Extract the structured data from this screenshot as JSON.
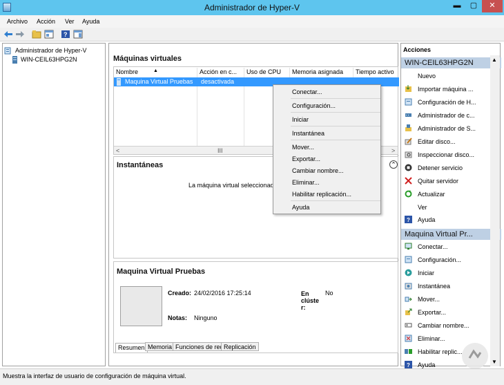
{
  "window": {
    "title": "Administrador de Hyper-V",
    "min": "▬",
    "max": "▢",
    "close": "✕"
  },
  "menu": [
    "Archivo",
    "Acción",
    "Ver",
    "Ayuda"
  ],
  "tree": {
    "root": "Administrador de Hyper-V",
    "server": "WIN-CEIL63HPG2N"
  },
  "vms": {
    "header": "Máquinas virtuales",
    "columns": [
      "Nombre",
      "Acción en c...",
      "Uso de CPU",
      "Memoria asignada",
      "Tiempo activo"
    ],
    "rows": [
      {
        "name": "Maquina Virtual Pruebas",
        "state": "desactivada"
      }
    ],
    "scroll": {
      "left": "<",
      "thumb": "III",
      "right": ">"
    }
  },
  "snapshots": {
    "header": "Instantáneas",
    "message": "La máquina virtual seleccionada n",
    "collapse": "⌃"
  },
  "details": {
    "header": "Maquina Virtual Pruebas",
    "created_label": "Creado:",
    "created_value": "24/02/2016 17:25:14",
    "cluster_label_1": "En",
    "cluster_label_2": "clúste",
    "cluster_label_3": "r:",
    "cluster_value": "No",
    "notes_label": "Notas:",
    "notes_value": "Ninguno",
    "tabs": [
      "Resumen",
      "Memoria",
      "Funciones de red",
      "Replicación"
    ]
  },
  "context_menu": {
    "items": [
      "Conectar...",
      "Configuración...",
      "Iniciar",
      "Instantánea",
      "Mover...",
      "Exportar...",
      "Cambiar nombre...",
      "Eliminar...",
      "Habilitar replicación...",
      "Ayuda"
    ]
  },
  "actions": {
    "title": "Acciones",
    "server_section": "WIN-CEIL63HPG2N",
    "server_items": [
      "Nuevo",
      "Importar máquina ...",
      "Configuración de H...",
      "Administrador de c...",
      "Administrador de S...",
      "Editar disco...",
      "Inspeccionar disco...",
      "Detener servicio",
      "Quitar servidor",
      "Actualizar",
      "Ver",
      "Ayuda"
    ],
    "vm_section": "Maquina Virtual Pr...",
    "vm_items": [
      "Conectar...",
      "Configuración...",
      "Iniciar",
      "Instantánea",
      "Mover...",
      "Exportar...",
      "Cambiar nombre...",
      "Eliminar...",
      "Habilitar replic...",
      "Ayuda"
    ],
    "submenu_arrow": "▶",
    "collapse_arrow": "▲"
  },
  "statusbar": {
    "text": "Muestra la interfaz de usuario de configuración de máquina virtual."
  },
  "scrollbar": {
    "up": "▲",
    "down": "▼"
  },
  "colors": {
    "titlebar": "#5ec5ee",
    "selection": "#3399ff",
    "section": "#bed0e4",
    "close": "#c75050"
  }
}
